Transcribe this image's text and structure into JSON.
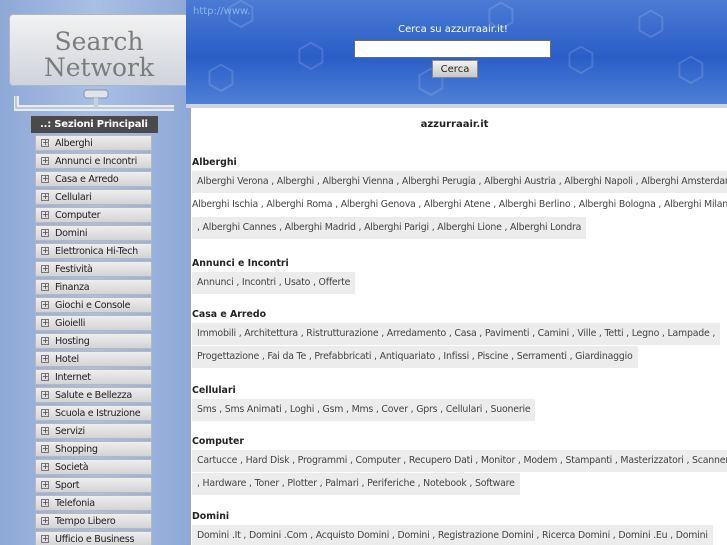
{
  "logo": {
    "line1": "Search",
    "line2": "Network"
  },
  "menu": {
    "header": "..: Sezioni Principali :..",
    "items": [
      "Alberghi",
      "Annunci e Incontri",
      "Casa e Arredo",
      "Cellulari",
      "Computer",
      "Domini",
      "Elettronica Hi-Tech",
      "Festività",
      "Finanza",
      "Giochi e Console",
      "Gioielli",
      "Hosting",
      "Hotel",
      "Internet",
      "Salute e Bellezza",
      "Scuola e Istruzione",
      "Servizi",
      "Shopping",
      "Società",
      "Sport",
      "Telefonia",
      "Tempo Libero",
      "Ufficio e Business"
    ]
  },
  "banner": {
    "url_text": "http://www.",
    "search_label": "Cerca su azzurraair.it!",
    "search_value": "",
    "search_button": "Cerca"
  },
  "main": {
    "site_title": "azzurraair.it",
    "sections": [
      {
        "title": "Alberghi",
        "lines": [
          "Alberghi Verona , Alberghi , Alberghi Vienna , Alberghi Perugia , Alberghi Austria , Alberghi Napoli , Alberghi Amsterdam ,",
          "Alberghi Ischia , Alberghi Roma , Alberghi Genova , Alberghi Atene , Alberghi Berlino , Alberghi Bologna , Alberghi Milano",
          ", Alberghi Cannes , Alberghi Madrid , Alberghi Parigi , Alberghi Lione , Alberghi Londra"
        ]
      },
      {
        "title": "Annunci e Incontri",
        "lines": [
          "Annunci , Incontri , Usato , Offerte"
        ]
      },
      {
        "title": "Casa e Arredo",
        "lines": [
          "Immobili , Architettura , Ristrutturazione , Arredamento , Casa , Pavimenti , Camini , Ville , Tetti , Legno , Lampade ,",
          "Progettazione , Fai da Te , Prefabbricati , Antiquariato , Infissi , Piscine , Serramenti , Giardinaggio"
        ]
      },
      {
        "title": "Cellulari",
        "lines": [
          "Sms , Sms Animati , Loghi , Gsm , Mms , Cover , Gprs , Cellulari , Suonerie"
        ]
      },
      {
        "title": "Computer",
        "lines": [
          "Cartucce , Hard Disk , Programmi , Computer , Recupero Dati , Monitor , Modem , Stampanti , Masterizzatori , Scanner",
          ", Hardware , Toner , Plotter , Palmari , Periferiche , Notebook , Software"
        ]
      },
      {
        "title": "Domini",
        "lines": [
          "Domini .It , Domini .Com , Acquisto Domini , Domini , Registrazione Domini , Ricerca Domini , Domini .Eu , Domini"
        ]
      }
    ]
  }
}
